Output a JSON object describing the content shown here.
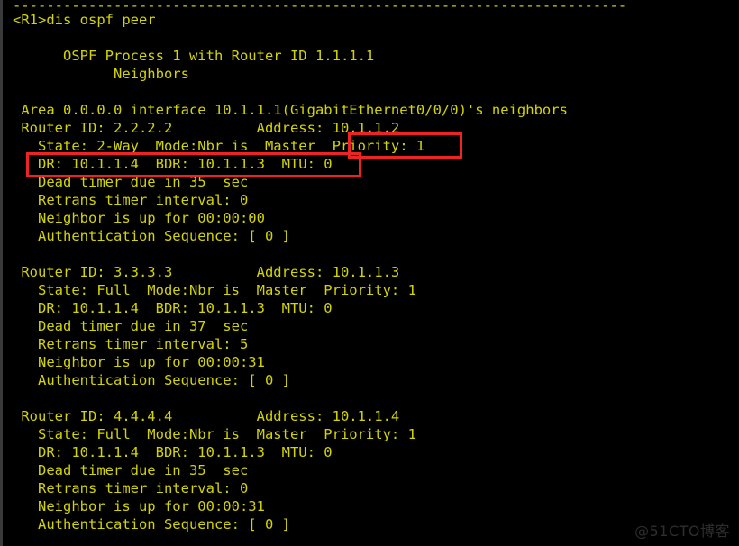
{
  "terminal": {
    "separator": "-------------------------------------------------------------------------",
    "prompt_line": "<R1>dis ospf peer",
    "process_header": "      OSPF Process 1 with Router ID 1.1.1.1",
    "neighbors_header": "            Neighbors",
    "area_line": " Area 0.0.0.0 interface 10.1.1.1(GigabitEthernet0/0/0)'s neighbors",
    "neighbors": [
      {
        "router_line": " Router ID: 2.2.2.2          Address: 10.1.1.2",
        "state_line": "   State: 2-Way  Mode:Nbr is  Master  Priority: 1",
        "dr_line": "   DR: 10.1.1.4  BDR: 10.1.1.3  MTU: 0",
        "dead_line": "   Dead timer due in 35  sec",
        "retrans_line": "   Retrans timer interval: 0",
        "uptime_line": "   Neighbor is up for 00:00:00",
        "auth_line": "   Authentication Sequence: [ 0 ]",
        "router_id": "2.2.2.2",
        "address": "10.1.1.2",
        "state": "2-Way",
        "mode": "Nbr is  Master",
        "priority": "1",
        "dr": "10.1.1.4",
        "bdr": "10.1.1.3",
        "mtu": "0",
        "dead_timer": "35",
        "retrans_interval": "0",
        "uptime": "00:00:00",
        "auth_sequence": "0"
      },
      {
        "router_line": " Router ID: 3.3.3.3          Address: 10.1.1.3",
        "state_line": "   State: Full  Mode:Nbr is  Master  Priority: 1",
        "dr_line": "   DR: 10.1.1.4  BDR: 10.1.1.3  MTU: 0",
        "dead_line": "   Dead timer due in 37  sec",
        "retrans_line": "   Retrans timer interval: 5",
        "uptime_line": "   Neighbor is up for 00:00:31",
        "auth_line": "   Authentication Sequence: [ 0 ]",
        "router_id": "3.3.3.3",
        "address": "10.1.1.3",
        "state": "Full",
        "mode": "Nbr is  Master",
        "priority": "1",
        "dr": "10.1.1.4",
        "bdr": "10.1.1.3",
        "mtu": "0",
        "dead_timer": "37",
        "retrans_interval": "5",
        "uptime": "00:00:31",
        "auth_sequence": "0"
      },
      {
        "router_line": " Router ID: 4.4.4.4          Address: 10.1.1.4",
        "state_line": "   State: Full  Mode:Nbr is  Master  Priority: 1",
        "dr_line": "   DR: 10.1.1.4  BDR: 10.1.1.3  MTU: 0",
        "dead_line": "   Dead timer due in 35  sec",
        "retrans_line": "   Retrans timer interval: 0",
        "uptime_line": "   Neighbor is up for 00:00:31",
        "auth_line": "   Authentication Sequence: [ 0 ]",
        "router_id": "4.4.4.4",
        "address": "10.1.1.4",
        "state": "Full",
        "mode": "Nbr is  Master",
        "priority": "1",
        "dr": "10.1.1.4",
        "bdr": "10.1.1.3",
        "mtu": "0",
        "dead_timer": "35",
        "retrans_interval": "0",
        "uptime": "00:00:31",
        "auth_sequence": "0"
      }
    ]
  },
  "annotations": {
    "color": "#ee2323",
    "priority_box_label": "Priority: 1",
    "drbdr_box_label": "DR: 10.1.1.4  BDR: 10.1.1.3  MTU: 0"
  },
  "watermark": {
    "text": "@51CTO博客",
    "color": "#2e2e2e"
  },
  "colors": {
    "background": "#000000",
    "text": "#d4d400",
    "border": "#3a3a3a"
  }
}
